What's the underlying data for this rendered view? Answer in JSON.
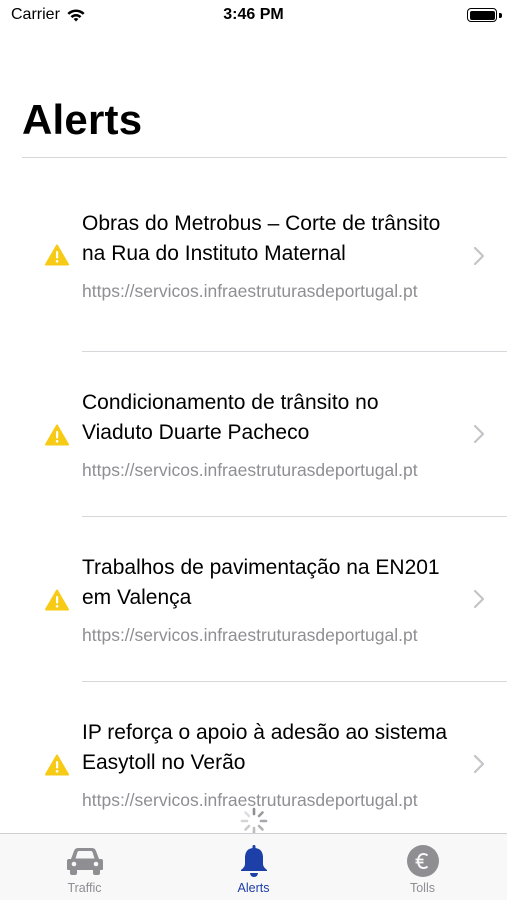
{
  "status_bar": {
    "carrier": "Carrier",
    "time": "3:46 PM"
  },
  "page_title": "Alerts",
  "alerts": [
    {
      "title": "Obras do Metrobus – Corte de trânsito na Rua do Instituto Maternal",
      "url": "https://servicos.infraestruturasdeportugal.pt",
      "icon": "warning-icon"
    },
    {
      "title": "Condicionamento de trânsito no Viaduto Duarte Pacheco",
      "url": "https://servicos.infraestruturasdeportugal.pt",
      "icon": "warning-icon"
    },
    {
      "title": "Trabalhos de pavimentação na EN201 em Valença",
      "url": "https://servicos.infraestruturasdeportugal.pt",
      "icon": "warning-icon"
    },
    {
      "title": "IP reforça o apoio à adesão ao sistema Easytoll no Verão",
      "url": "https://servicos.infraestruturasdeportugal.pt",
      "icon": "warning-icon"
    }
  ],
  "tabs": [
    {
      "label": "Traffic",
      "icon": "car-icon",
      "active": false
    },
    {
      "label": "Alerts",
      "icon": "bell-icon",
      "active": true
    },
    {
      "label": "Tolls",
      "icon": "euro-icon",
      "active": false
    }
  ],
  "colors": {
    "accent": "#1c3fa8",
    "warning": "#f7cb15",
    "inactive": "#8e8e93"
  }
}
